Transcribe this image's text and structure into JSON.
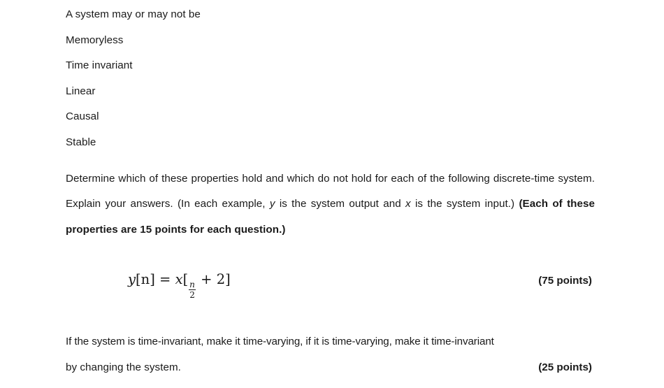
{
  "document": {
    "intro_lines": [
      "A system may or may not be",
      "Memoryless",
      "Time invariant",
      "Linear",
      "Causal",
      "Stable"
    ],
    "instruction_paragraph": {
      "segment_1": "Determine which of these properties hold and which do not hold for each of the following discrete-time system. Explain your answers. (In each example, ",
      "italic_y": "y",
      "segment_2": " is the system output and ",
      "italic_x": "x",
      "segment_3": " is the system input.) ",
      "bold_tail": "(Each of these properties are 15 points for each question.)"
    },
    "equation": {
      "lhs_var": "y",
      "lhs_index": "[n]",
      "equals": " = ",
      "rhs_var": "x",
      "open_bracket": "[",
      "fraction_numerator": "n",
      "fraction_denominator": "2",
      "plus_term": " + 2",
      "close_bracket": "]",
      "points_label": "(75 points)"
    },
    "final_paragraph": {
      "line_1": "If the system is time-invariant, make it time-varying, if it is time-varying, make it time-invariant",
      "line_2": "by changing the system.",
      "points_label": "(25 points)"
    }
  },
  "style": {
    "text_color": "#1a1a1a",
    "background_color": "#ffffff"
  }
}
